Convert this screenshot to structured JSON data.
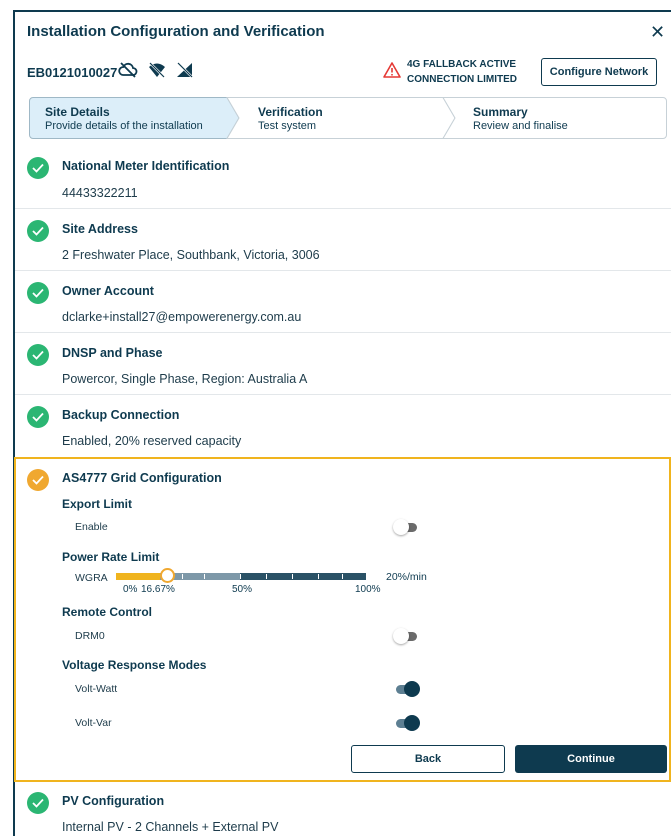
{
  "window": {
    "title": "Installation Configuration and Verification",
    "close_label": "✕"
  },
  "device": {
    "id": "EB0121010027",
    "status_icons": [
      "cloud-off-icon",
      "wifi-off-icon",
      "signal-off-icon"
    ]
  },
  "network_warning": {
    "line1": "4G FALLBACK ACTIVE",
    "line2": "CONNECTION LIMITED",
    "icon": "warning-triangle-icon",
    "color": "#e53935"
  },
  "configure_network_label": "Configure Network",
  "steps": [
    {
      "title": "Site Details",
      "subtitle": "Provide details of the installation",
      "active": true
    },
    {
      "title": "Verification",
      "subtitle": "Test system",
      "active": false
    },
    {
      "title": "Summary",
      "subtitle": "Review and finalise",
      "active": false
    }
  ],
  "sections": [
    {
      "title": "National Meter Identification",
      "value": "44433322211",
      "status": "complete"
    },
    {
      "title": "Site Address",
      "value": "2 Freshwater Place, Southbank, Victoria, 3006",
      "status": "complete"
    },
    {
      "title": "Owner Account",
      "value": "dclarke+install27@empowerenergy.com.au",
      "status": "complete"
    },
    {
      "title": "DNSP and Phase",
      "value": "Powercor, Single Phase, Region: Australia A",
      "status": "complete"
    },
    {
      "title": "Backup Connection",
      "value": "Enabled, 20% reserved capacity",
      "status": "complete"
    }
  ],
  "grid_config": {
    "title": "AS4777 Grid Configuration",
    "status": "in-progress",
    "export_limit": {
      "heading": "Export Limit",
      "enable_label": "Enable",
      "enabled": false
    },
    "power_rate_limit": {
      "heading": "Power Rate Limit",
      "label": "WGRA",
      "value_percent": 16.67,
      "tick_labels": [
        "0%",
        "16.67%",
        "50%",
        "100%"
      ],
      "rate_text": "20%/min"
    },
    "remote_control": {
      "heading": "Remote Control",
      "drm0_label": "DRM0",
      "enabled": false
    },
    "voltage_response": {
      "heading": "Voltage Response Modes",
      "volt_watt_label": "Volt-Watt",
      "volt_watt_enabled": true,
      "volt_var_label": "Volt-Var",
      "volt_var_enabled": true
    },
    "back_label": "Back",
    "continue_label": "Continue"
  },
  "pv_config": {
    "title": "PV Configuration",
    "value": "Internal PV - 2 Channels + External PV",
    "status": "complete"
  },
  "colors": {
    "primary": "#0e3a4f",
    "success": "#2bb673",
    "warning": "#f0a830",
    "highlight_border": "#f0b41e"
  }
}
